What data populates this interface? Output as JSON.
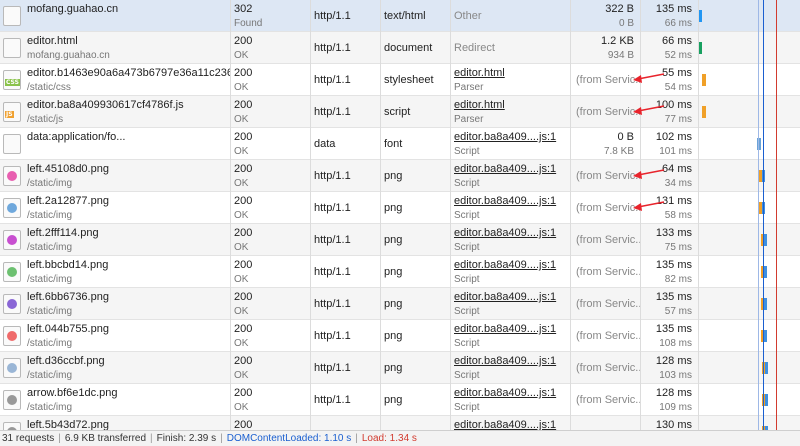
{
  "requests": [
    {
      "name": "mofang.guahao.cn",
      "path": "",
      "status": "302",
      "status_text": "Found",
      "protocol": "http/1.1",
      "type": "text/html",
      "initiator": "Other",
      "initiator_sub": "",
      "size": "322 B",
      "size_sub": "0 B",
      "time": "135 ms",
      "time_sub": "66 ms",
      "icon": "document",
      "selected": true,
      "wf_color": "#2196f3"
    },
    {
      "name": "editor.html",
      "path": "mofang.guahao.cn",
      "status": "200",
      "status_text": "OK",
      "protocol": "http/1.1",
      "type": "document",
      "initiator": "Redirect",
      "initiator_sub": "",
      "size": "1.2 KB",
      "size_sub": "934 B",
      "time": "66 ms",
      "time_sub": "52 ms",
      "icon": "document",
      "wf_color": "#18a060"
    },
    {
      "name": "editor.b1463e90a6a473b6797e36a11c23673d...",
      "path": "/static/css",
      "status": "200",
      "status_text": "OK",
      "protocol": "http/1.1",
      "type": "stylesheet",
      "initiator": "editor.html",
      "initiator_link": true,
      "initiator_sub": "Parser",
      "size": "(from Servic...",
      "time": "55 ms",
      "time_sub": "54 ms",
      "icon": "css",
      "wf_color": "#f0a028"
    },
    {
      "name": "editor.ba8a409930617cf4786f.js",
      "path": "/static/js",
      "status": "200",
      "status_text": "OK",
      "protocol": "http/1.1",
      "type": "script",
      "initiator": "editor.html",
      "initiator_link": true,
      "initiator_sub": "Parser",
      "size": "(from Servic...",
      "time": "100 ms",
      "time_sub": "77 ms",
      "icon": "js",
      "wf_color": "#f0a028"
    },
    {
      "name": "data:application/fo...",
      "path": "",
      "status": "200",
      "status_text": "OK",
      "protocol": "data",
      "type": "font",
      "initiator": "editor.ba8a409....js:1",
      "initiator_link": true,
      "initiator_sub": "Script",
      "size": "0 B",
      "size_sub": "7.8 KB",
      "time": "102 ms",
      "time_sub": "101 ms",
      "icon": "document",
      "wf_color": "#6aa3d8"
    },
    {
      "name": "left.45108d0.png",
      "path": "/static/img",
      "status": "200",
      "status_text": "OK",
      "protocol": "http/1.1",
      "type": "png",
      "initiator": "editor.ba8a409....js:1",
      "initiator_link": true,
      "initiator_sub": "Script",
      "size": "(from Servic...",
      "time": "64 ms",
      "time_sub": "34 ms",
      "icon": "image",
      "icon_color": "#e85fb0",
      "wf_color": "#f0a028"
    },
    {
      "name": "left.2a12877.png",
      "path": "/static/img",
      "status": "200",
      "status_text": "OK",
      "protocol": "http/1.1",
      "type": "png",
      "initiator": "editor.ba8a409....js:1",
      "initiator_link": true,
      "initiator_sub": "Script",
      "size": "(from Servic...",
      "time": "131 ms",
      "time_sub": "58 ms",
      "icon": "image",
      "icon_color": "#6fa8dc",
      "wf_color": "#f0a028"
    },
    {
      "name": "left.2fff114.png",
      "path": "/static/img",
      "status": "200",
      "status_text": "OK",
      "protocol": "http/1.1",
      "type": "png",
      "initiator": "editor.ba8a409....js:1",
      "initiator_link": true,
      "initiator_sub": "Script",
      "size": "(from Servic...",
      "time": "133 ms",
      "time_sub": "75 ms",
      "icon": "image",
      "icon_color": "#c84fd0",
      "wf_color": "#f0a028"
    },
    {
      "name": "left.bbcbd14.png",
      "path": "/static/img",
      "status": "200",
      "status_text": "OK",
      "protocol": "http/1.1",
      "type": "png",
      "initiator": "editor.ba8a409....js:1",
      "initiator_link": true,
      "initiator_sub": "Script",
      "size": "(from Servic...",
      "time": "135 ms",
      "time_sub": "82 ms",
      "icon": "image",
      "icon_color": "#6cc070",
      "wf_color": "#f0a028"
    },
    {
      "name": "left.6bb6736.png",
      "path": "/static/img",
      "status": "200",
      "status_text": "OK",
      "protocol": "http/1.1",
      "type": "png",
      "initiator": "editor.ba8a409....js:1",
      "initiator_link": true,
      "initiator_sub": "Script",
      "size": "(from Servic...",
      "time": "135 ms",
      "time_sub": "57 ms",
      "icon": "image",
      "icon_color": "#8a66d6",
      "wf_color": "#f0a028"
    },
    {
      "name": "left.044b755.png",
      "path": "/static/img",
      "status": "200",
      "status_text": "OK",
      "protocol": "http/1.1",
      "type": "png",
      "initiator": "editor.ba8a409....js:1",
      "initiator_link": true,
      "initiator_sub": "Script",
      "size": "(from Servic...",
      "time": "135 ms",
      "time_sub": "108 ms",
      "icon": "image",
      "icon_color": "#ef6a6a",
      "wf_color": "#f0a028"
    },
    {
      "name": "left.d36ccbf.png",
      "path": "/static/img",
      "status": "200",
      "status_text": "OK",
      "protocol": "http/1.1",
      "type": "png",
      "initiator": "editor.ba8a409....js:1",
      "initiator_link": true,
      "initiator_sub": "Script",
      "size": "(from Servic...",
      "time": "128 ms",
      "time_sub": "103 ms",
      "icon": "image",
      "icon_color": "#9ab6d6",
      "wf_color": "#f0a028"
    },
    {
      "name": "arrow.bf6e1dc.png",
      "path": "/static/img",
      "status": "200",
      "status_text": "OK",
      "protocol": "http/1.1",
      "type": "png",
      "initiator": "editor.ba8a409....js:1",
      "initiator_link": true,
      "initiator_sub": "Script",
      "size": "(from Servic...",
      "time": "128 ms",
      "time_sub": "109 ms",
      "icon": "image",
      "icon_color": "#999999",
      "wf_color": "#f0a028"
    },
    {
      "name": "left.5b43d72.png",
      "path": "",
      "status": "200",
      "status_text": "",
      "protocol": "",
      "type": "",
      "initiator": "editor.ba8a409....js:1",
      "initiator_link": true,
      "initiator_sub": "",
      "size": "",
      "time": "130 ms",
      "time_sub": "",
      "icon": "image",
      "icon_color": "#999999",
      "wf_color": "#f0a028"
    }
  ],
  "status_bar": {
    "requests": "31 requests",
    "transferred": "6.9 KB transferred",
    "finish": "Finish: 2.39 s",
    "dom_content_loaded": "DOMContentLoaded: 1.10 s",
    "load": "Load: 1.34 s"
  },
  "colors": {
    "selected_row": "#dde7f4",
    "annotation_arrow": "#e8242c",
    "dcl_line": "#1a5fd0",
    "load_line": "#d23b2f"
  }
}
